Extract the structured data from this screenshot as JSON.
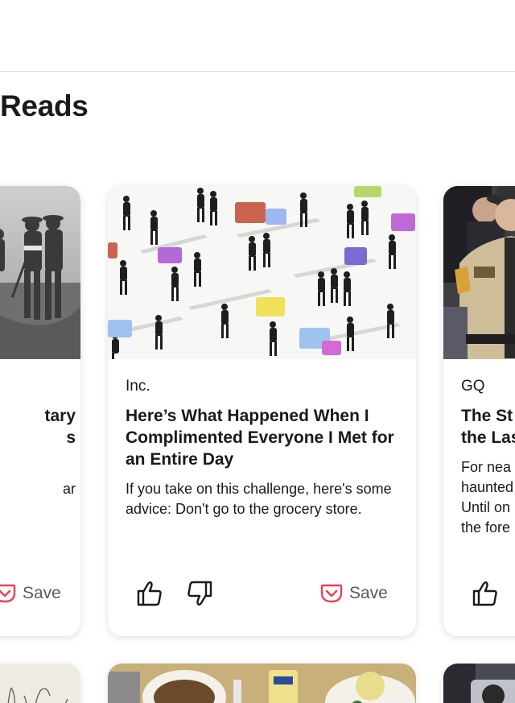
{
  "section": {
    "title": "Reads"
  },
  "colors": {
    "save_accent": "#ef4056",
    "text": "#1a1a1a",
    "muted": "#5a5a5a"
  },
  "cards": [
    {
      "publisher": "",
      "headline_fragments": [
        "tary",
        "s"
      ],
      "excerpt_fragments": [
        "ar"
      ],
      "save_label": "Save",
      "image": "historical-soldiers-photo"
    },
    {
      "publisher": "Inc.",
      "headline": "Here’s What Happened When I Complimented Everyone I Met for an Entire Day",
      "excerpt": "If you take on this challenge, here's some advice: Don't go to the grocery store.",
      "save_label": "Save",
      "like_icon": "thumbs-up-icon",
      "dislike_icon": "thumbs-down-icon",
      "save_icon": "pocket-icon",
      "image": "people-silhouettes-speech-bubbles-illustration"
    },
    {
      "publisher": "GQ",
      "headline_fragments": [
        "The St",
        "the Las"
      ],
      "excerpt_fragments": [
        "For nea",
        "haunted",
        "Until on",
        "the fore"
      ],
      "like_icon": "thumbs-up-icon",
      "image": "police-officer-photo"
    }
  ],
  "bottom_row": [
    "botanical-sketch-image",
    "cafeteria-food-tray-image",
    "camera-crowd-image"
  ]
}
